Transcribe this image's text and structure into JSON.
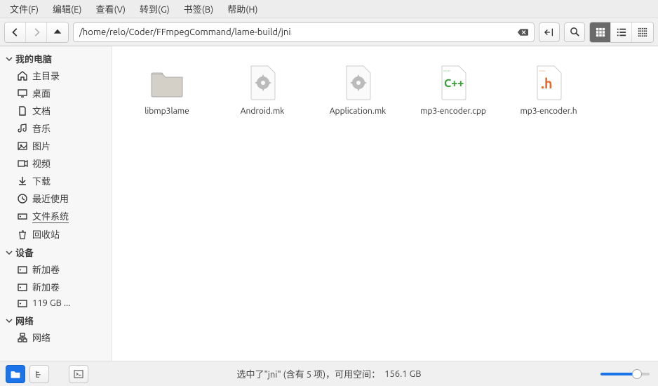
{
  "menubar": {
    "items": [
      "文件(F)",
      "编辑(E)",
      "查看(V)",
      "转到(G)",
      "书签(B)",
      "帮助(H)"
    ]
  },
  "toolbar": {
    "path": "/home/relo/Coder/FFmpegCommand/lame-build/jni"
  },
  "sidebar": {
    "sections": [
      {
        "header": "我的电脑",
        "items": [
          {
            "icon": "home",
            "label": "主目录"
          },
          {
            "icon": "desktop",
            "label": "桌面"
          },
          {
            "icon": "doc",
            "label": "文档"
          },
          {
            "icon": "music",
            "label": "音乐"
          },
          {
            "icon": "pic",
            "label": "图片"
          },
          {
            "icon": "video",
            "label": "视频"
          },
          {
            "icon": "download",
            "label": "下载"
          },
          {
            "icon": "recent",
            "label": "最近使用"
          },
          {
            "icon": "fs",
            "label": "文件系统",
            "active": true
          },
          {
            "icon": "trash",
            "label": "回收站"
          }
        ]
      },
      {
        "header": "设备",
        "items": [
          {
            "icon": "disk",
            "label": "新加卷"
          },
          {
            "icon": "disk",
            "label": "新加卷"
          },
          {
            "icon": "disk",
            "label": "119 GB ..."
          }
        ]
      },
      {
        "header": "网络",
        "items": [
          {
            "icon": "network",
            "label": "网络"
          }
        ]
      }
    ]
  },
  "files": [
    {
      "type": "folder",
      "name": "libmp3lame"
    },
    {
      "type": "mk",
      "name": "Android.mk"
    },
    {
      "type": "mk",
      "name": "Application.mk"
    },
    {
      "type": "cpp",
      "name": "mp3-encoder.cpp"
    },
    {
      "type": "h",
      "name": "mp3-encoder.h"
    }
  ],
  "status": {
    "text": "选中了\"jni\" (含有 5 项)，可用空间：",
    "free": "156.1 GB"
  }
}
